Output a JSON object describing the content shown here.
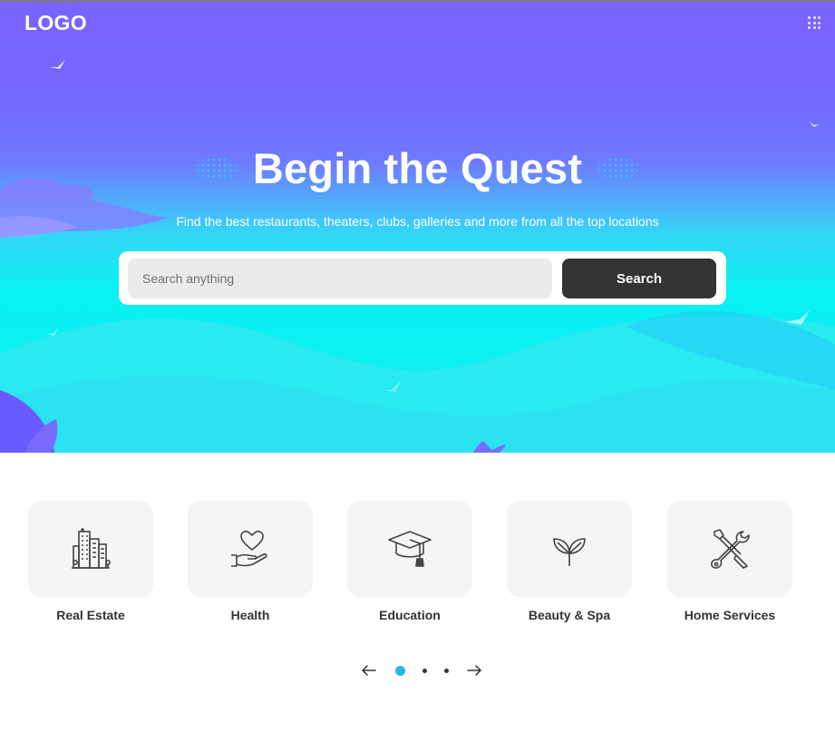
{
  "header": {
    "logo": "LOGO",
    "apps_icon": "grid-icon"
  },
  "hero": {
    "title": "Begin the Quest",
    "subtitle": "Find the best restaurants, theaters, clubs, galleries and more from all the top locations",
    "search": {
      "placeholder": "Search anything",
      "value": "",
      "button_label": "Search"
    }
  },
  "categories": [
    {
      "label": "Real Estate",
      "icon": "buildings-icon"
    },
    {
      "label": "Health",
      "icon": "heart-hand-icon"
    },
    {
      "label": "Education",
      "icon": "graduation-cap-icon"
    },
    {
      "label": "Beauty & Spa",
      "icon": "sprout-icon"
    },
    {
      "label": "Home Services",
      "icon": "tools-icon"
    }
  ],
  "pager": {
    "pages": 3,
    "active_page": 1
  },
  "colors": {
    "accent": "#2ab4f0",
    "button_dark": "#333333",
    "hero_top": "#7a63ff",
    "hero_bottom": "#08f1f3"
  }
}
